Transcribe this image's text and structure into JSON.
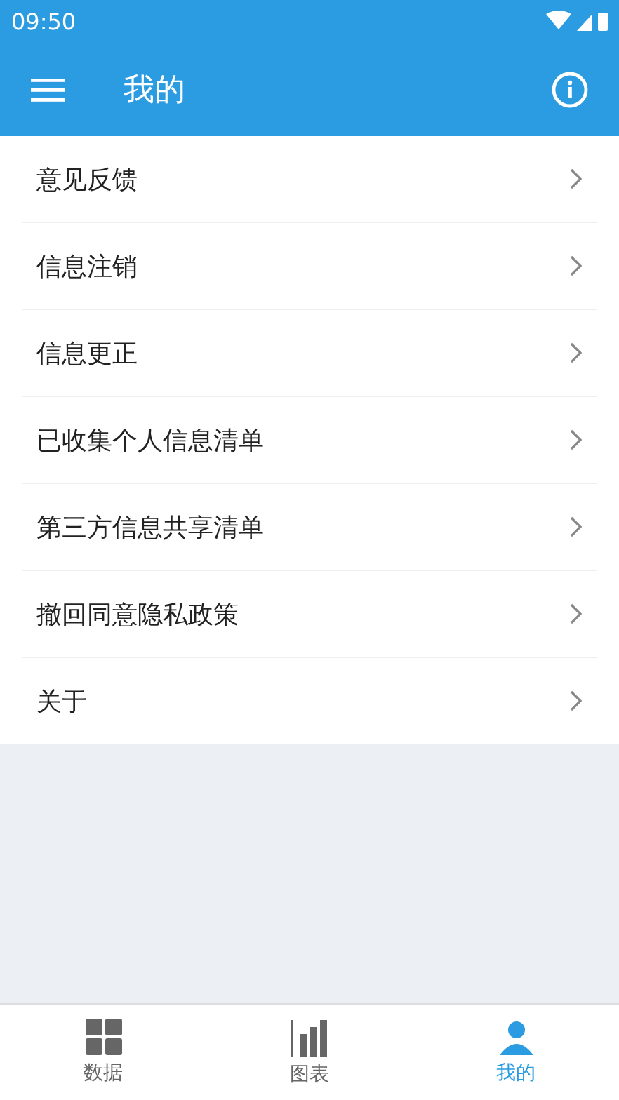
{
  "status_bar": {
    "time": "09:50"
  },
  "app_bar": {
    "title": "我的"
  },
  "menu_items": [
    {
      "label": "意见反馈"
    },
    {
      "label": "信息注销"
    },
    {
      "label": "信息更正"
    },
    {
      "label": "已收集个人信息清单"
    },
    {
      "label": "第三方信息共享清单"
    },
    {
      "label": "撤回同意隐私政策"
    },
    {
      "label": "关于"
    }
  ],
  "bottom_nav": [
    {
      "label": "数据",
      "kind": "grid",
      "selected": false
    },
    {
      "label": "图表",
      "kind": "bars",
      "selected": false
    },
    {
      "label": "我的",
      "kind": "person",
      "selected": true
    }
  ]
}
